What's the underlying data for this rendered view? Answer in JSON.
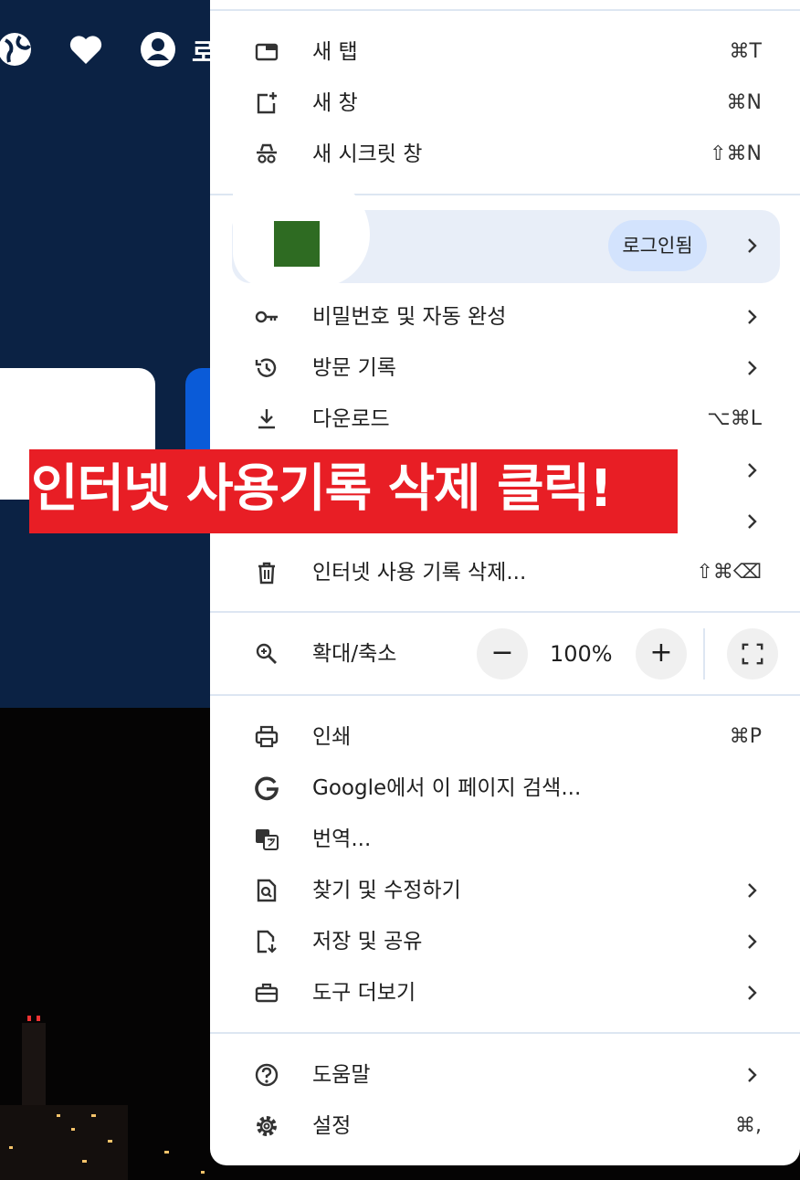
{
  "background": {
    "header_letter": "로"
  },
  "menu": {
    "group1": [
      {
        "label": "새 탭",
        "shortcut": "⌘T",
        "icon": "new-tab-icon"
      },
      {
        "label": "새 창",
        "shortcut": "⌘N",
        "icon": "new-window-icon"
      },
      {
        "label": "새 시크릿 창",
        "shortcut": "⇧⌘N",
        "icon": "incognito-icon"
      }
    ],
    "profile": {
      "status": "로그인됨"
    },
    "group2": [
      {
        "label": "비밀번호 및 자동 완성",
        "icon": "key-icon"
      },
      {
        "label": "방문 기록",
        "icon": "history-icon"
      },
      {
        "label": "다운로드",
        "shortcut": "⌥⌘L",
        "icon": "download-icon"
      },
      {
        "label": "인터넷 사용 기록 삭제...",
        "shortcut": "⇧⌘⌫",
        "icon": "trash-icon"
      }
    ],
    "zoom": {
      "label": "확대/축소",
      "value": "100%",
      "minus": "−",
      "plus": "+"
    },
    "group3": [
      {
        "label": "인쇄",
        "shortcut": "⌘P",
        "icon": "print-icon"
      },
      {
        "label": "Google에서 이 페이지 검색...",
        "icon": "google-icon"
      },
      {
        "label": "번역...",
        "icon": "translate-icon"
      },
      {
        "label": "찾기 및 수정하기",
        "icon": "find-icon"
      },
      {
        "label": "저장 및 공유",
        "icon": "save-share-icon"
      },
      {
        "label": "도구 더보기",
        "icon": "toolbox-icon"
      }
    ],
    "group4": [
      {
        "label": "도움말",
        "icon": "help-icon"
      },
      {
        "label": "설정",
        "shortcut": "⌘,",
        "icon": "gear-icon"
      }
    ]
  },
  "annotation": {
    "text": "인터넷 사용기록 삭제 클릭!"
  },
  "colors": {
    "banner": "#e81e25",
    "profile_bg": "#e8eef8",
    "signed_chip": "#d3e3fd",
    "site_bg": "#0b2244"
  }
}
